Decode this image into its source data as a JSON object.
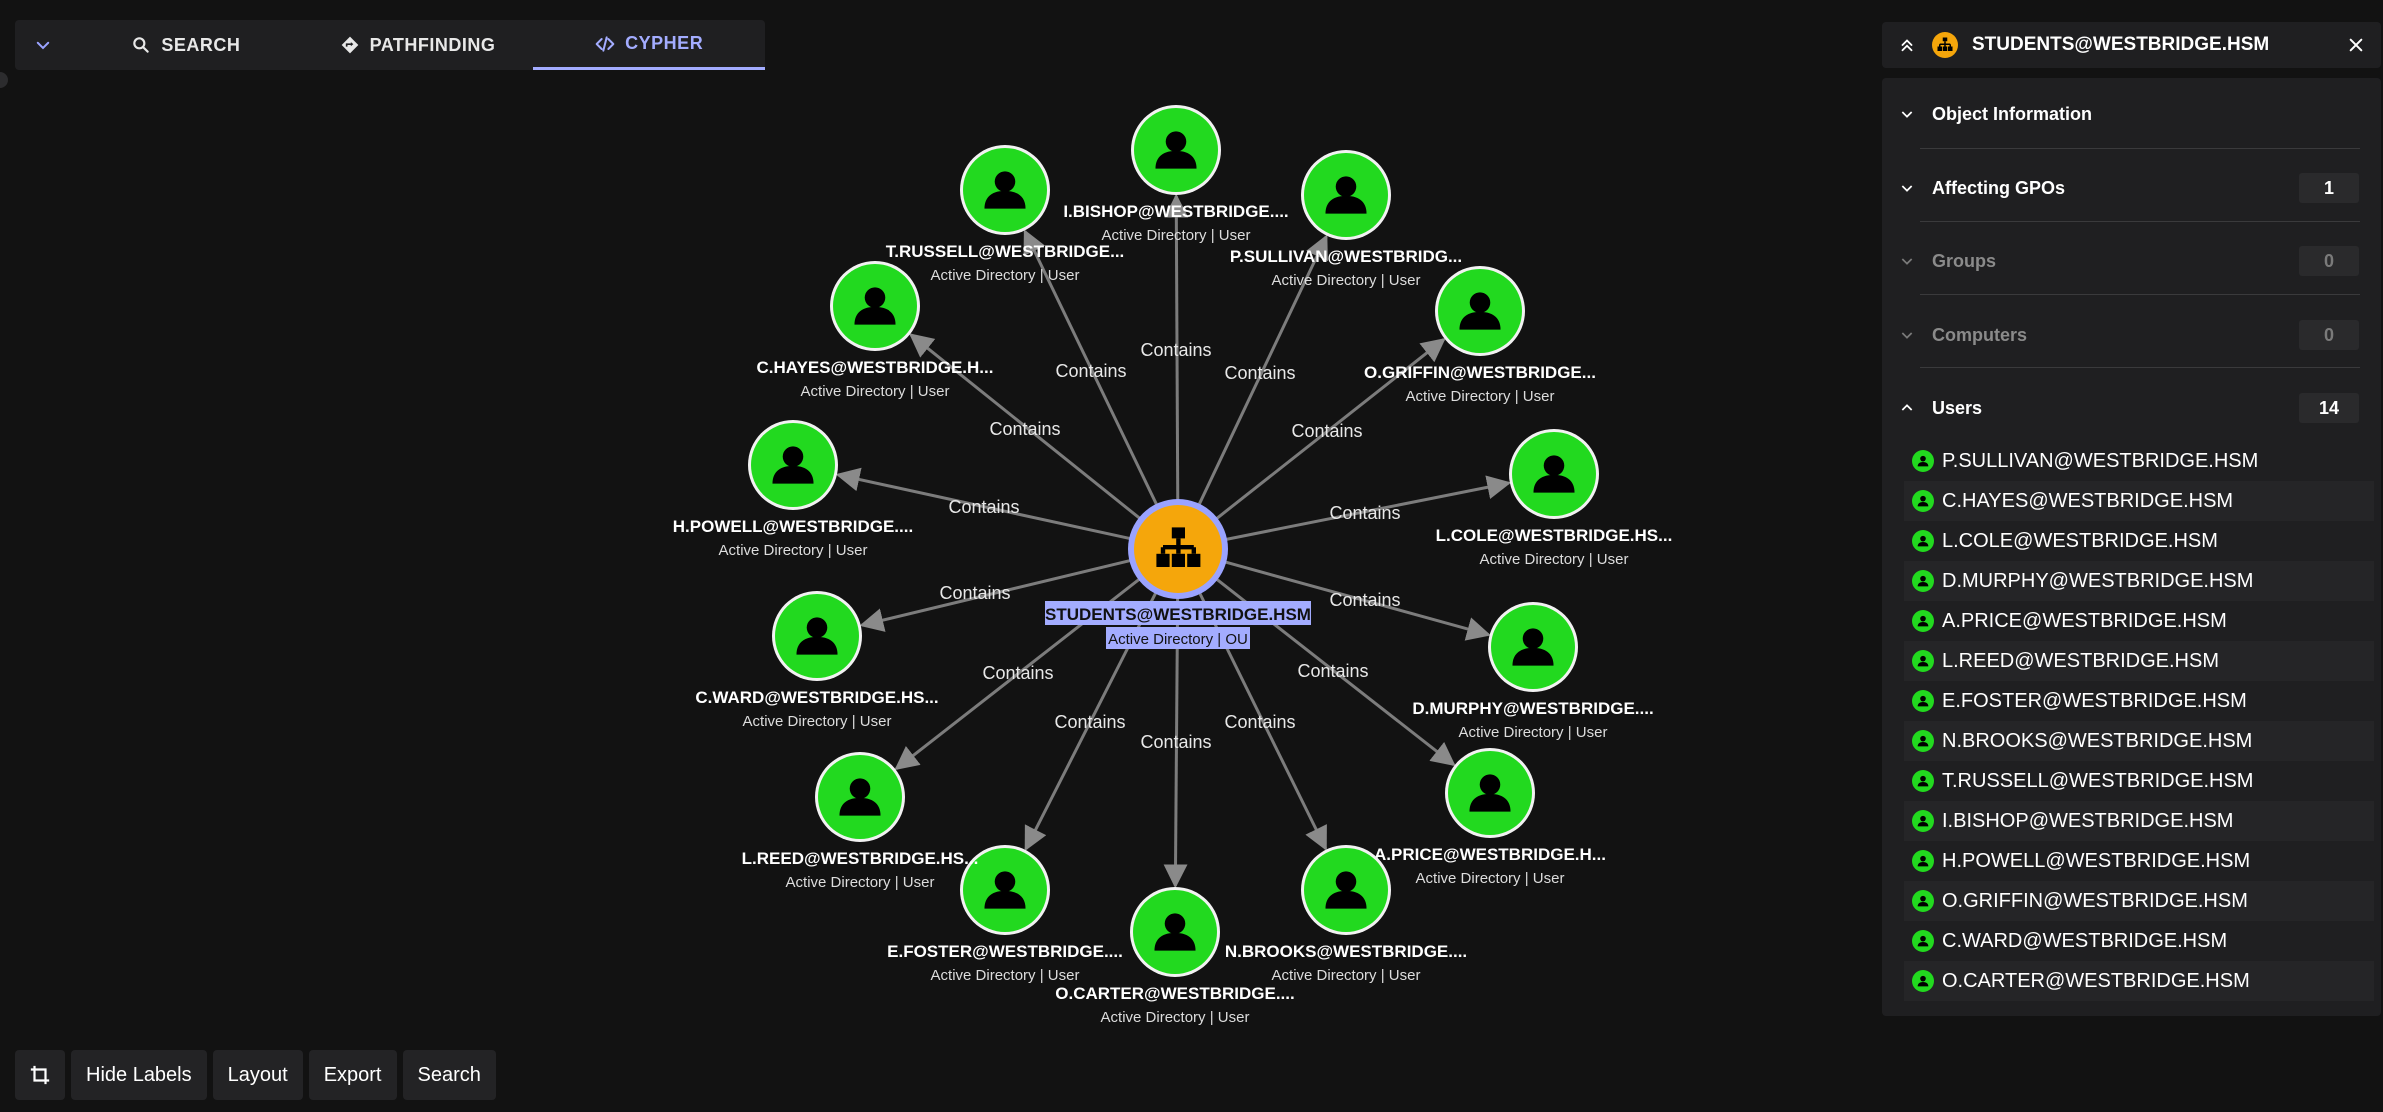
{
  "tabs": [
    {
      "label": "SEARCH",
      "icon": "search-icon"
    },
    {
      "label": "PATHFINDING",
      "icon": "pathfinding-icon"
    },
    {
      "label": "CYPHER",
      "icon": "code-icon",
      "active": true
    }
  ],
  "graph": {
    "center": {
      "name": "STUDENTS@WESTBRIDGE.HSM",
      "sub": "Active Directory | OU",
      "color": "#f5a60b"
    },
    "edge_label": "Contains",
    "node_color": "#22d91f",
    "users": [
      {
        "label": "I.BISHOP@WESTBRIDGE....",
        "sub": "Active Directory | User"
      },
      {
        "label": "P.SULLIVAN@WESTBRIDG...",
        "sub": "Active Directory | User"
      },
      {
        "label": "O.GRIFFIN@WESTBRIDGE...",
        "sub": "Active Directory | User"
      },
      {
        "label": "L.COLE@WESTBRIDGE.HS...",
        "sub": "Active Directory | User"
      },
      {
        "label": "D.MURPHY@WESTBRIDGE....",
        "sub": "Active Directory | User"
      },
      {
        "label": "A.PRICE@WESTBRIDGE.H...",
        "sub": "Active Directory | User"
      },
      {
        "label": "N.BROOKS@WESTBRIDGE....",
        "sub": "Active Directory | User"
      },
      {
        "label": "O.CARTER@WESTBRIDGE....",
        "sub": "Active Directory | User"
      },
      {
        "label": "E.FOSTER@WESTBRIDGE....",
        "sub": "Active Directory | User"
      },
      {
        "label": "L.REED@WESTBRIDGE.HS...",
        "sub": "Active Directory | User"
      },
      {
        "label": "C.WARD@WESTBRIDGE.HS...",
        "sub": "Active Directory | User"
      },
      {
        "label": "H.POWELL@WESTBRIDGE....",
        "sub": "Active Directory | User"
      },
      {
        "label": "C.HAYES@WESTBRIDGE.H...",
        "sub": "Active Directory | User"
      },
      {
        "label": "T.RUSSELL@WESTBRIDGE...",
        "sub": "Active Directory | User"
      }
    ]
  },
  "toolbar": {
    "crop_icon": "crop-icon",
    "hide_labels": "Hide Labels",
    "layout": "Layout",
    "export": "Export",
    "search": "Search"
  },
  "panel": {
    "title": "STUDENTS@WESTBRIDGE.HSM",
    "sections": [
      {
        "label": "Object Information",
        "count": null,
        "expanded": false
      },
      {
        "label": "Affecting GPOs",
        "count": "1",
        "expanded": false
      },
      {
        "label": "Groups",
        "count": "0",
        "expanded": false,
        "disabled": true
      },
      {
        "label": "Computers",
        "count": "0",
        "expanded": false,
        "disabled": true
      },
      {
        "label": "Users",
        "count": "14",
        "expanded": true
      }
    ],
    "users": [
      "P.SULLIVAN@WESTBRIDGE.HSM",
      "C.HAYES@WESTBRIDGE.HSM",
      "L.COLE@WESTBRIDGE.HSM",
      "D.MURPHY@WESTBRIDGE.HSM",
      "A.PRICE@WESTBRIDGE.HSM",
      "L.REED@WESTBRIDGE.HSM",
      "E.FOSTER@WESTBRIDGE.HSM",
      "N.BROOKS@WESTBRIDGE.HSM",
      "T.RUSSELL@WESTBRIDGE.HSM",
      "I.BISHOP@WESTBRIDGE.HSM",
      "H.POWELL@WESTBRIDGE.HSM",
      "O.GRIFFIN@WESTBRIDGE.HSM",
      "C.WARD@WESTBRIDGE.HSM",
      "O.CARTER@WESTBRIDGE.HSM"
    ]
  }
}
